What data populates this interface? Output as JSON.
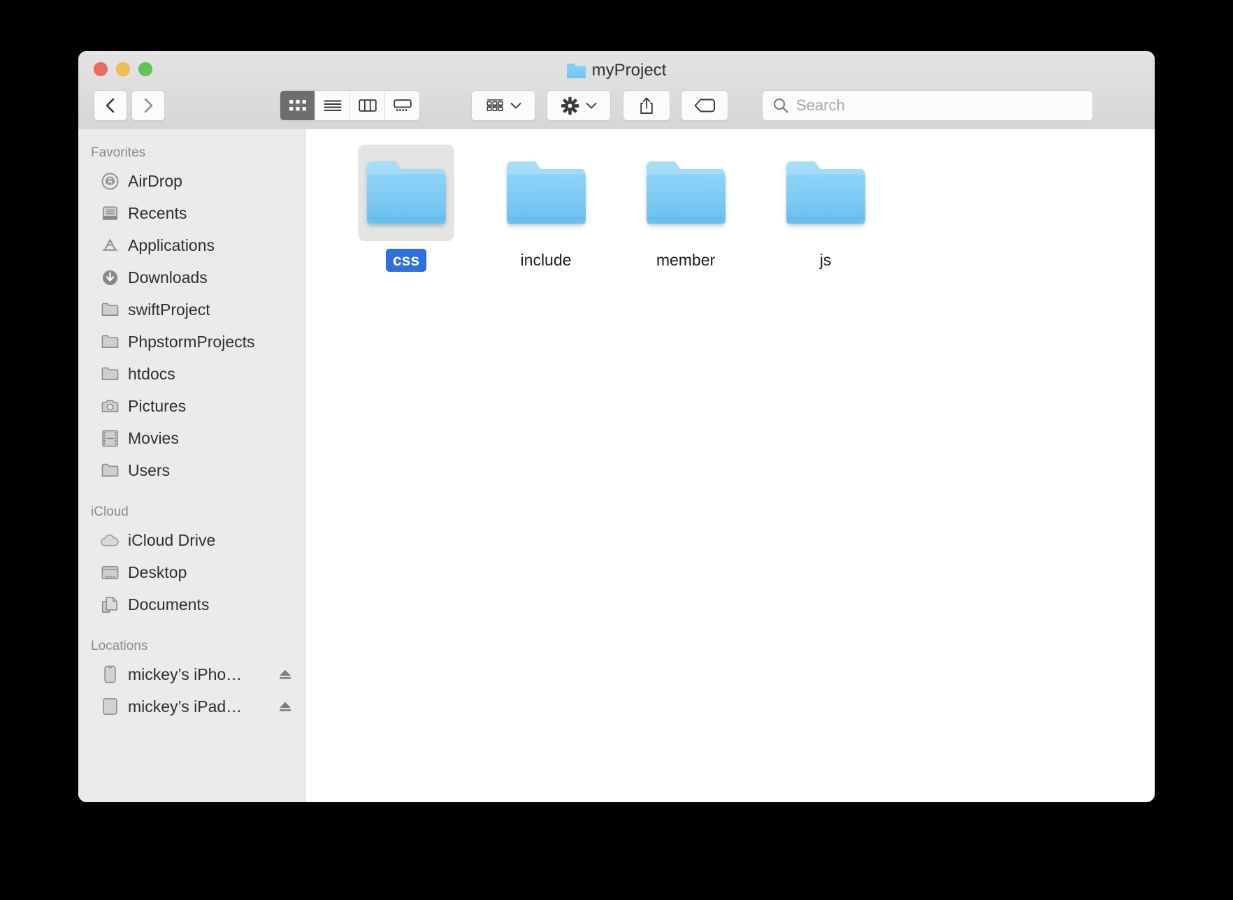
{
  "window": {
    "title": "myProject",
    "title_icon": "folder-icon",
    "traffic_lights": [
      {
        "name": "close-button",
        "color": "#ec6a5f"
      },
      {
        "name": "minimize-button",
        "color": "#f4bd4f"
      },
      {
        "name": "maximize-button",
        "color": "#61c555"
      }
    ]
  },
  "toolbar": {
    "back_icon": "chevron-left-icon",
    "forward_icon": "chevron-right-icon",
    "view_modes": [
      {
        "label": "Icon View",
        "icon": "grid-icon",
        "active": true
      },
      {
        "label": "List View",
        "icon": "list-icon",
        "active": false
      },
      {
        "label": "Column View",
        "icon": "columns-icon",
        "active": false
      },
      {
        "label": "Gallery View",
        "icon": "gallery-icon",
        "active": false
      }
    ],
    "arrange": {
      "label": "Arrange By",
      "icon": "group-icon",
      "chevron": "chevron-down-icon"
    },
    "action": {
      "label": "Action",
      "icon": "gear-icon",
      "chevron": "chevron-down-icon"
    },
    "share": {
      "label": "Share",
      "icon": "share-icon"
    },
    "tags": {
      "label": "Tags",
      "icon": "tag-icon"
    }
  },
  "search": {
    "placeholder": "Search",
    "value": "",
    "icon": "search-icon"
  },
  "sidebar": {
    "sections": [
      {
        "title": "Favorites",
        "items": [
          {
            "label": "AirDrop",
            "icon": "airdrop-icon"
          },
          {
            "label": "Recents",
            "icon": "recents-icon"
          },
          {
            "label": "Applications",
            "icon": "applications-icon"
          },
          {
            "label": "Downloads",
            "icon": "downloads-icon"
          },
          {
            "label": "swiftProject",
            "icon": "folder-icon"
          },
          {
            "label": "PhpstormProjects",
            "icon": "folder-icon"
          },
          {
            "label": "htdocs",
            "icon": "folder-icon"
          },
          {
            "label": "Pictures",
            "icon": "camera-icon"
          },
          {
            "label": "Movies",
            "icon": "film-icon"
          },
          {
            "label": "Users",
            "icon": "folder-icon"
          }
        ]
      },
      {
        "title": "iCloud",
        "items": [
          {
            "label": "iCloud Drive",
            "icon": "cloud-icon"
          },
          {
            "label": "Desktop",
            "icon": "desktop-icon"
          },
          {
            "label": "Documents",
            "icon": "documents-icon"
          }
        ]
      },
      {
        "title": "Locations",
        "items": [
          {
            "label": "mickey’s iPho…",
            "icon": "iphone-icon",
            "eject": "eject-icon"
          },
          {
            "label": "mickey’s iPad…",
            "icon": "ipad-icon",
            "eject": "eject-icon"
          }
        ]
      }
    ]
  },
  "content": {
    "items": [
      {
        "label": "css",
        "icon": "folder-icon",
        "selected": true
      },
      {
        "label": "include",
        "icon": "folder-icon",
        "selected": false
      },
      {
        "label": "member",
        "icon": "folder-icon",
        "selected": false
      },
      {
        "label": "js",
        "icon": "folder-icon",
        "selected": false
      }
    ]
  },
  "colors": {
    "selection_blue": "#2f6fdd",
    "folder_blue": "#7cc9f2",
    "sidebar_bg": "#ebebeb",
    "titlebar_bg": "#dcdcdc",
    "active_segment": "#6e6e6e"
  }
}
